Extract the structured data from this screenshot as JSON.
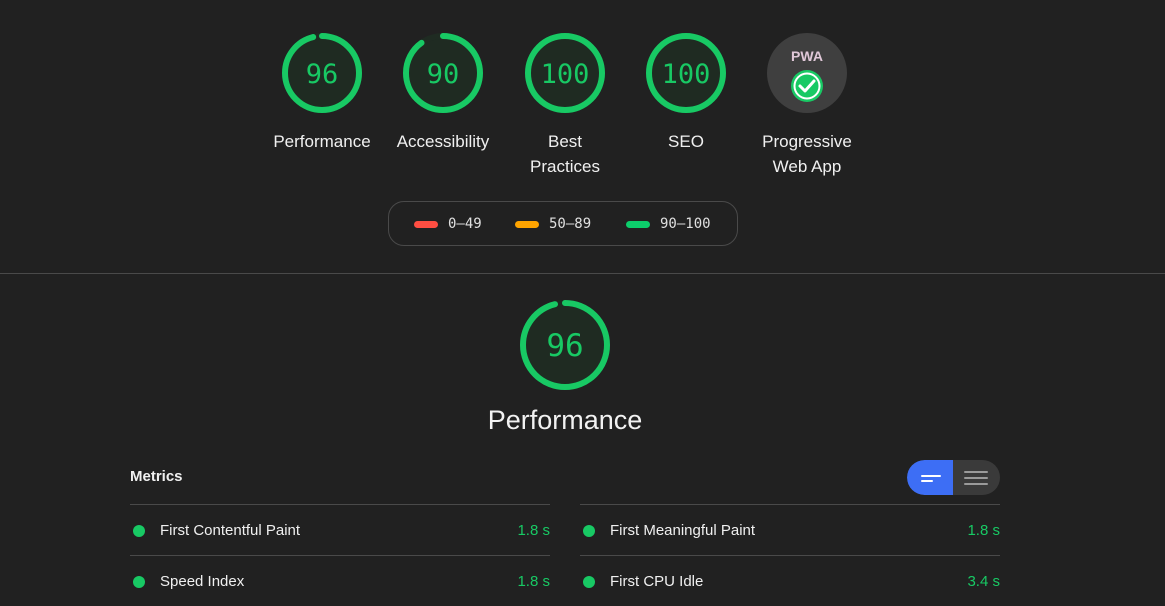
{
  "categories": [
    {
      "id": "performance",
      "label": "Performance",
      "score": "96",
      "fraction": 0.96
    },
    {
      "id": "accessibility",
      "label": "Accessibility",
      "score": "90",
      "fraction": 0.9
    },
    {
      "id": "best-practices",
      "label": "Best\nPractices",
      "score": "100",
      "fraction": 1.0
    },
    {
      "id": "seo",
      "label": "SEO",
      "score": "100",
      "fraction": 1.0
    }
  ],
  "pwa": {
    "label": "Progressive\nWeb App",
    "badge_text": "PWA",
    "status_icon": "check-circle-icon"
  },
  "legend": [
    {
      "range": "0–49",
      "color": "#ff4e42"
    },
    {
      "range": "50–89",
      "color": "#ffa400"
    },
    {
      "range": "90–100",
      "color": "#0cce6b"
    }
  ],
  "performance": {
    "title": "Performance",
    "score": "96",
    "fraction": 0.96,
    "metrics_header": "Metrics",
    "view_toggle": {
      "active": "opportunity-view-icon",
      "inactive": "list-view-icon"
    },
    "metrics_left": [
      {
        "name": "First Contentful Paint",
        "value": "1.8 s"
      },
      {
        "name": "Speed Index",
        "value": "1.8 s"
      }
    ],
    "metrics_right": [
      {
        "name": "First Meaningful Paint",
        "value": "1.8 s"
      },
      {
        "name": "First CPU Idle",
        "value": "3.4 s"
      }
    ]
  },
  "colors": {
    "background": "#212121",
    "pass": "#18c964",
    "accent": "#3d6ef5",
    "divider": "#4a4a4a"
  }
}
